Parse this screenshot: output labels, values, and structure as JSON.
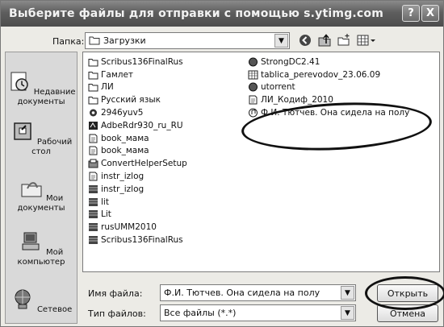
{
  "window": {
    "title": "Выберите файлы для отправки с помощью s.ytimg.com",
    "help": "?",
    "close": "X"
  },
  "toolbar": {
    "folder_label": "Папка:",
    "folder_value": "Загрузки"
  },
  "places": [
    {
      "label": "Недавние документы",
      "icon": "recent-documents-icon"
    },
    {
      "label": "Рабочий стол",
      "icon": "desktop-icon"
    },
    {
      "label": "Мои документы",
      "icon": "my-documents-icon"
    },
    {
      "label": "Мой компьютер",
      "icon": "my-computer-icon"
    },
    {
      "label": "Сетевое",
      "icon": "network-icon"
    }
  ],
  "files_col1": [
    {
      "name": "Scribus136FinalRus",
      "icon": "folder-icon"
    },
    {
      "name": "Гамлет",
      "icon": "folder-icon"
    },
    {
      "name": "ЛИ",
      "icon": "folder-icon"
    },
    {
      "name": "Русский язык",
      "icon": "folder-icon"
    },
    {
      "name": "2946yuv5",
      "icon": "gear-file-icon"
    },
    {
      "name": "AdbeRdr930_ru_RU",
      "icon": "installer-icon"
    },
    {
      "name": "book_мама",
      "icon": "document-icon"
    },
    {
      "name": "book_мама",
      "icon": "document-icon"
    },
    {
      "name": "ConvertHelperSetup",
      "icon": "setup-icon"
    },
    {
      "name": "instr_izlog",
      "icon": "document-icon"
    },
    {
      "name": "instr_izlog",
      "icon": "archive-icon"
    },
    {
      "name": "lit",
      "icon": "archive-icon"
    },
    {
      "name": "Lit",
      "icon": "archive-icon"
    },
    {
      "name": "rusUMM2010",
      "icon": "archive-icon"
    },
    {
      "name": "Scribus136FinalRus",
      "icon": "archive-icon"
    }
  ],
  "files_col2": [
    {
      "name": "StrongDC2.41",
      "icon": "app-icon"
    },
    {
      "name": "tablica_perevodov_23.06.09",
      "icon": "spreadsheet-icon"
    },
    {
      "name": "utorrent",
      "icon": "app-icon"
    },
    {
      "name": "ЛИ_Кодиф_2010",
      "icon": "document-icon"
    },
    {
      "name": "Ф.И. Тютчев. Она сидела на полу",
      "icon": "audio-file-icon"
    }
  ],
  "filename": {
    "label": "Имя файла:",
    "value": "Ф.И. Тютчев. Она сидела на полу"
  },
  "filetype": {
    "label": "Тип файлов:",
    "value": "Все файлы (*.*)"
  },
  "buttons": {
    "open": "Открыть",
    "cancel": "Отмена"
  }
}
